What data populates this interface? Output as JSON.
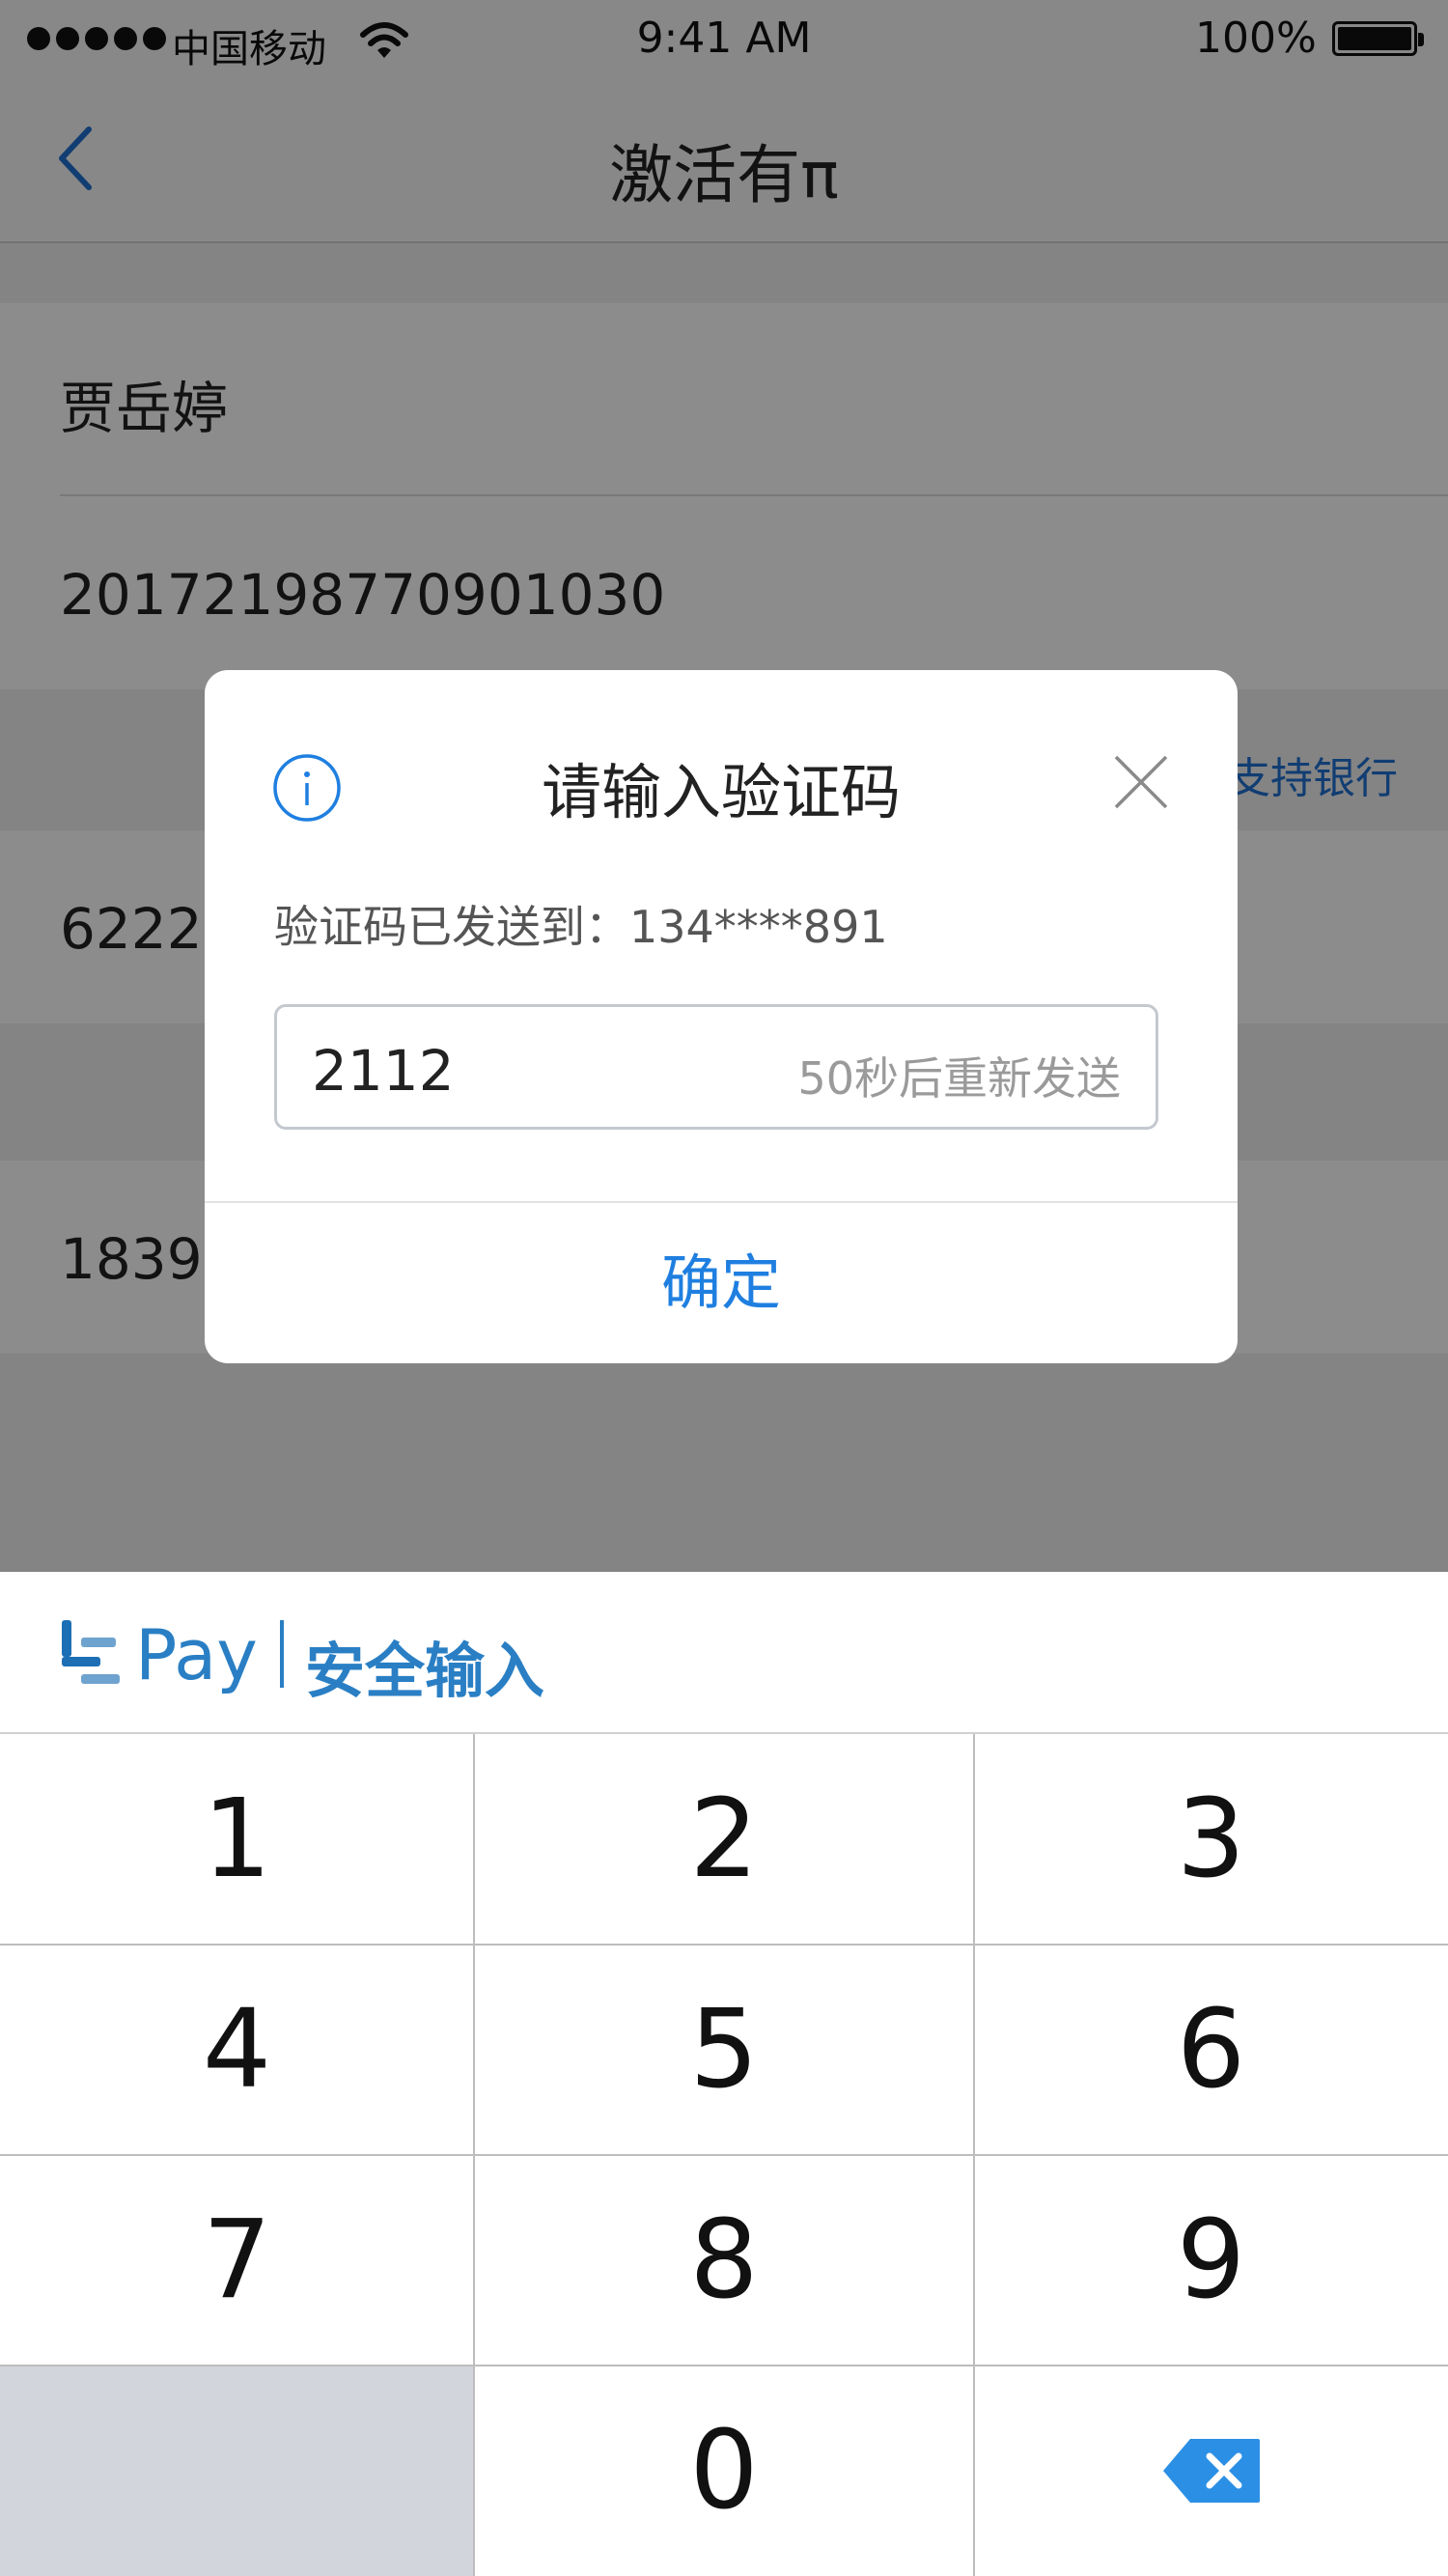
{
  "status_bar": {
    "carrier": "中国移动",
    "time": "9:41 AM",
    "battery": "100%"
  },
  "nav": {
    "title": "激活有π",
    "back_icon": "chevron-left-icon"
  },
  "form": {
    "name": "贾岳婷",
    "id_number": "20172198770901030",
    "support_banks_link": "支持银行",
    "card_number_partial": "6222",
    "phone_partial": "1839"
  },
  "dialog": {
    "info_icon": "info-icon",
    "title": "请输入验证码",
    "close_icon": "close-icon",
    "sent_to_label": "验证码已发送到：",
    "sent_to_number": "134****891",
    "code_value": "2112",
    "resend_countdown": "50秒后重新发送",
    "confirm_label": "确定"
  },
  "keyboard": {
    "brand": "Pay",
    "secure_label": "安全输入",
    "keys": [
      "1",
      "2",
      "3",
      "4",
      "5",
      "6",
      "7",
      "8",
      "9",
      "0"
    ],
    "backspace_icon": "backspace-icon"
  },
  "colors": {
    "accent": "#1f7fe0",
    "brand": "#2a7fc4",
    "link": "#1f6fd0"
  }
}
